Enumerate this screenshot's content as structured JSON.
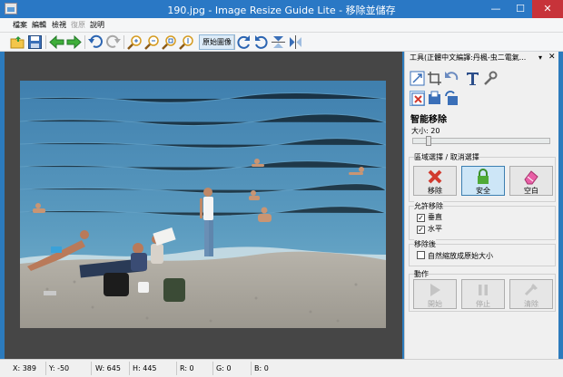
{
  "window": {
    "title": "190.jpg - Image Resize Guide Lite - 移除並儲存",
    "min": "—",
    "max": "☐",
    "close": "✕"
  },
  "menu": [
    {
      "label": "檔案",
      "enabled": true
    },
    {
      "label": "編輯",
      "enabled": true
    },
    {
      "label": "檢視",
      "enabled": true
    },
    {
      "label": "復原",
      "enabled": false
    },
    {
      "label": "說明",
      "enabled": true
    }
  ],
  "toolbar": {
    "original_size_label": "原始圖像",
    "icons": [
      "open-icon",
      "save-icon",
      "back-icon",
      "forward-icon",
      "undo-icon",
      "redo-icon",
      "zoom-in-icon",
      "zoom-out-icon",
      "zoom-fit-icon",
      "zoom-actual-icon",
      "rotate-cw-icon",
      "rotate-ccw-icon",
      "flip-vertical-icon",
      "flip-horizontal-icon"
    ]
  },
  "panel": {
    "header": "工具(正體中文編譯:丹楓-虫二電氣...",
    "pin": "▾",
    "close": "✕",
    "section_title": "智能移除",
    "size_label": "大小: 20",
    "size_value": 20,
    "select_group": {
      "label": "區域選擇 / 取消選擇",
      "buttons": [
        {
          "label": "移除",
          "icon": "remove-x-icon",
          "active": false
        },
        {
          "label": "安全",
          "icon": "lock-icon",
          "active": true
        },
        {
          "label": "空白",
          "icon": "eraser-icon",
          "active": false
        }
      ]
    },
    "allow_group": {
      "label": "允許移除",
      "options": [
        {
          "label": "垂直",
          "checked": true
        },
        {
          "label": "水平",
          "checked": true
        }
      ]
    },
    "after_group": {
      "label": "移除後",
      "options": [
        {
          "label": "自然縮放成原始大小",
          "checked": false
        }
      ]
    },
    "action_group": {
      "label": "動作",
      "buttons": [
        {
          "label": "開始",
          "icon": "play-icon"
        },
        {
          "label": "停止",
          "icon": "pause-icon"
        },
        {
          "label": "清除",
          "icon": "clear-icon"
        }
      ]
    }
  },
  "status": {
    "x": "X: 389",
    "y": "Y: -50",
    "w": "W: 645",
    "h": "H: 445",
    "r": "R: 0",
    "g": "G: 0",
    "b": "B: 0"
  },
  "colors": {
    "titlebar": "#2a78c5",
    "close_button": "#c7333a",
    "canvas_bg": "#464646",
    "sea": "#4e8fb8",
    "shore": "#aeaaa4"
  }
}
